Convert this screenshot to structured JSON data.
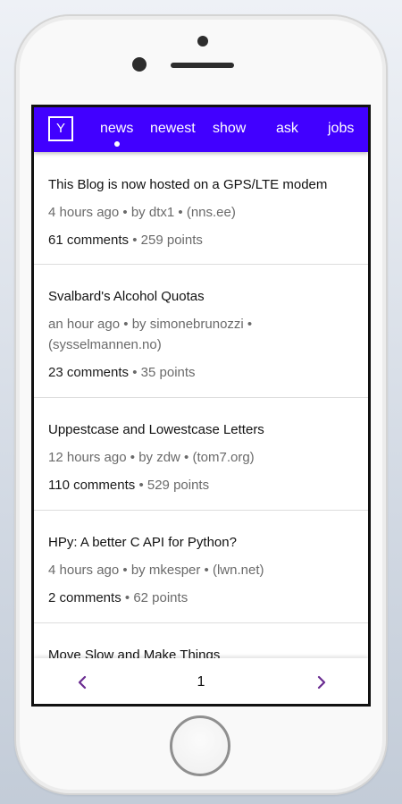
{
  "nav": {
    "logo": "Y",
    "links": [
      {
        "label": "news",
        "active": true
      },
      {
        "label": "newest",
        "active": false
      },
      {
        "label": "show",
        "active": false
      },
      {
        "label": "ask",
        "active": false
      },
      {
        "label": "jobs",
        "active": false
      }
    ]
  },
  "stories": [
    {
      "title": "This Blog is now hosted on a GPS/LTE modem",
      "time": "4 hours ago",
      "by": "by dtx1",
      "domain": "(nns.ee)",
      "comments": "61 comments",
      "points": "259 points"
    },
    {
      "title": "Svalbard's Alcohol Quotas",
      "time": "an hour ago",
      "by": "by simonebrunozzi",
      "domain": "(sysselmannen.no)",
      "comments": "23 comments",
      "points": "35 points"
    },
    {
      "title": "Uppestcase and Lowestcase Letters",
      "time": "12 hours ago",
      "by": "by zdw",
      "domain": "(tom7.org)",
      "comments": "110 comments",
      "points": "529 points"
    },
    {
      "title": "HPy: A better C API for Python?",
      "time": "4 hours ago",
      "by": "by mkesper",
      "domain": "(lwn.net)",
      "comments": "2 comments",
      "points": "62 points"
    },
    {
      "title": "Move Slow and Make Things"
    }
  ],
  "pager": {
    "page": "1",
    "prev_icon": "chevron-left-icon",
    "next_icon": "chevron-right-icon"
  },
  "colors": {
    "accent": "#4100ff",
    "arrow": "#6a2c91"
  },
  "separator": "•"
}
